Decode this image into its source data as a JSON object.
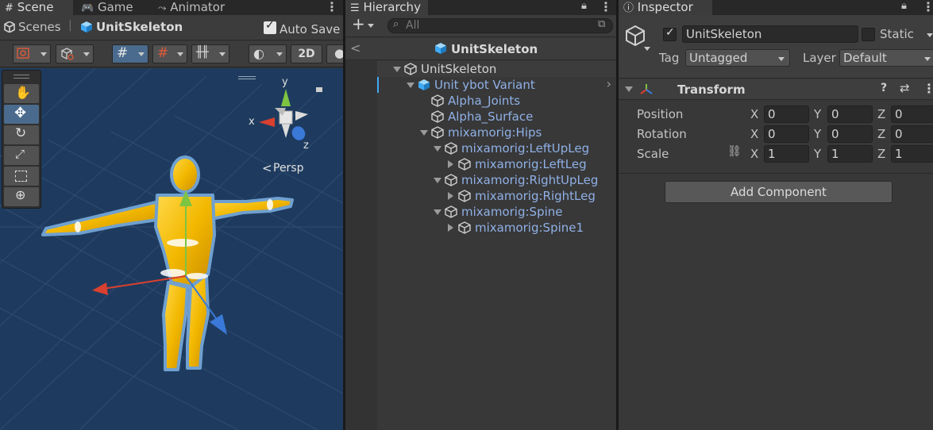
{
  "scene_panel": {
    "tabs": [
      {
        "label": "Scene",
        "icon": "grid-icon"
      },
      {
        "label": "Game",
        "icon": "gamepad-icon"
      },
      {
        "label": "Animator",
        "icon": "animator-icon"
      }
    ],
    "breadcrumb": {
      "root": "Scenes",
      "current": "UnitSkeleton"
    },
    "auto_save_label": "Auto Save",
    "auto_save_checked": true,
    "toolbar": {
      "mode_2d_label": "2D"
    },
    "gizmo": {
      "y_label": "y",
      "x_label": "x",
      "z_label": "z",
      "persp_label": "Persp"
    },
    "tools": [
      "hand-tool-icon",
      "move-tool-icon",
      "rotate-tool-icon",
      "scale-tool-icon",
      "rect-tool-icon",
      "transform-tool-icon"
    ]
  },
  "hierarchy_panel": {
    "tab_label": "Hierarchy",
    "search_placeholder": "All",
    "prefab_header": "UnitSkeleton",
    "items": [
      {
        "label": "UnitSkeleton",
        "depth": 0,
        "expanded": true,
        "kind": "gameobject"
      },
      {
        "label": "Unit ybot Variant",
        "depth": 1,
        "expanded": true,
        "kind": "prefab"
      },
      {
        "label": "Alpha_Joints",
        "depth": 2,
        "expanded": null,
        "kind": "gameobject"
      },
      {
        "label": "Alpha_Surface",
        "depth": 2,
        "expanded": null,
        "kind": "gameobject"
      },
      {
        "label": "mixamorig:Hips",
        "depth": 2,
        "expanded": true,
        "kind": "gameobject"
      },
      {
        "label": "mixamorig:LeftUpLeg",
        "depth": 3,
        "expanded": true,
        "kind": "gameobject"
      },
      {
        "label": "mixamorig:LeftLeg",
        "depth": 4,
        "expanded": false,
        "kind": "gameobject"
      },
      {
        "label": "mixamorig:RightUpLeg",
        "depth": 3,
        "expanded": true,
        "kind": "gameobject"
      },
      {
        "label": "mixamorig:RightLeg",
        "depth": 4,
        "expanded": false,
        "kind": "gameobject"
      },
      {
        "label": "mixamorig:Spine",
        "depth": 3,
        "expanded": true,
        "kind": "gameobject"
      },
      {
        "label": "mixamorig:Spine1",
        "depth": 4,
        "expanded": false,
        "kind": "gameobject"
      }
    ]
  },
  "inspector_panel": {
    "tab_label": "Inspector",
    "object_name": "UnitSkeleton",
    "active_checked": true,
    "static_label": "Static",
    "tag_label": "Tag",
    "tag_value": "Untagged",
    "layer_label": "Layer",
    "layer_value": "Default",
    "component_title": "Transform",
    "position": {
      "label": "Position",
      "x": "0",
      "y": "0",
      "z": "0"
    },
    "rotation": {
      "label": "Rotation",
      "x": "0",
      "y": "0",
      "z": "0"
    },
    "scale": {
      "label": "Scale",
      "x": "1",
      "y": "1",
      "z": "1"
    },
    "axis_labels": {
      "x": "X",
      "y": "Y",
      "z": "Z"
    },
    "add_component_label": "Add Component"
  },
  "colors": {
    "viewport_bg": "#1e3b5f",
    "character": "#f2b800",
    "selection_outline": "#6fa0d0",
    "gizmo_x": "#d8402f",
    "gizmo_y": "#7ec443",
    "gizmo_z": "#3a79d8",
    "hierarchy_link": "#8fb0e6"
  }
}
